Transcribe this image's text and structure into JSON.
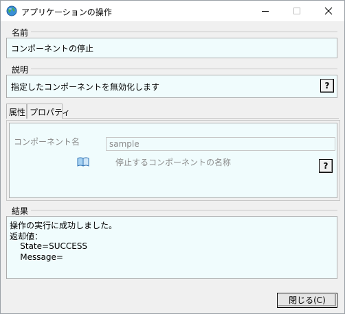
{
  "window": {
    "title": "アプリケーションの操作",
    "icon": "globe-icon",
    "controls": {
      "minimize": "minimize-icon",
      "maximize": "maximize-icon",
      "close": "close-icon"
    }
  },
  "name_group": {
    "label": "名前",
    "value": "コンポーネントの停止"
  },
  "description_group": {
    "label": "説明",
    "value": "指定したコンポーネントを無効化します",
    "help_label": "?"
  },
  "tabs": [
    {
      "label": "属性"
    },
    {
      "label": "プロパティ"
    }
  ],
  "property": {
    "label": "コンポーネント名",
    "value": "sample",
    "description": "停止するコンポーネントの名称",
    "help_label": "?",
    "icon": "book-icon"
  },
  "result_group": {
    "label": "結果",
    "lines": [
      "操作の実行に成功しました。",
      "返却値：",
      "    State=SUCCESS",
      "    Message="
    ]
  },
  "footer": {
    "close_label": "閉じる(C)"
  },
  "colors": {
    "panel_bg": "#f0fcfd",
    "window_bg": "#f0f0f0",
    "help_bg": "#f0f0f0"
  }
}
